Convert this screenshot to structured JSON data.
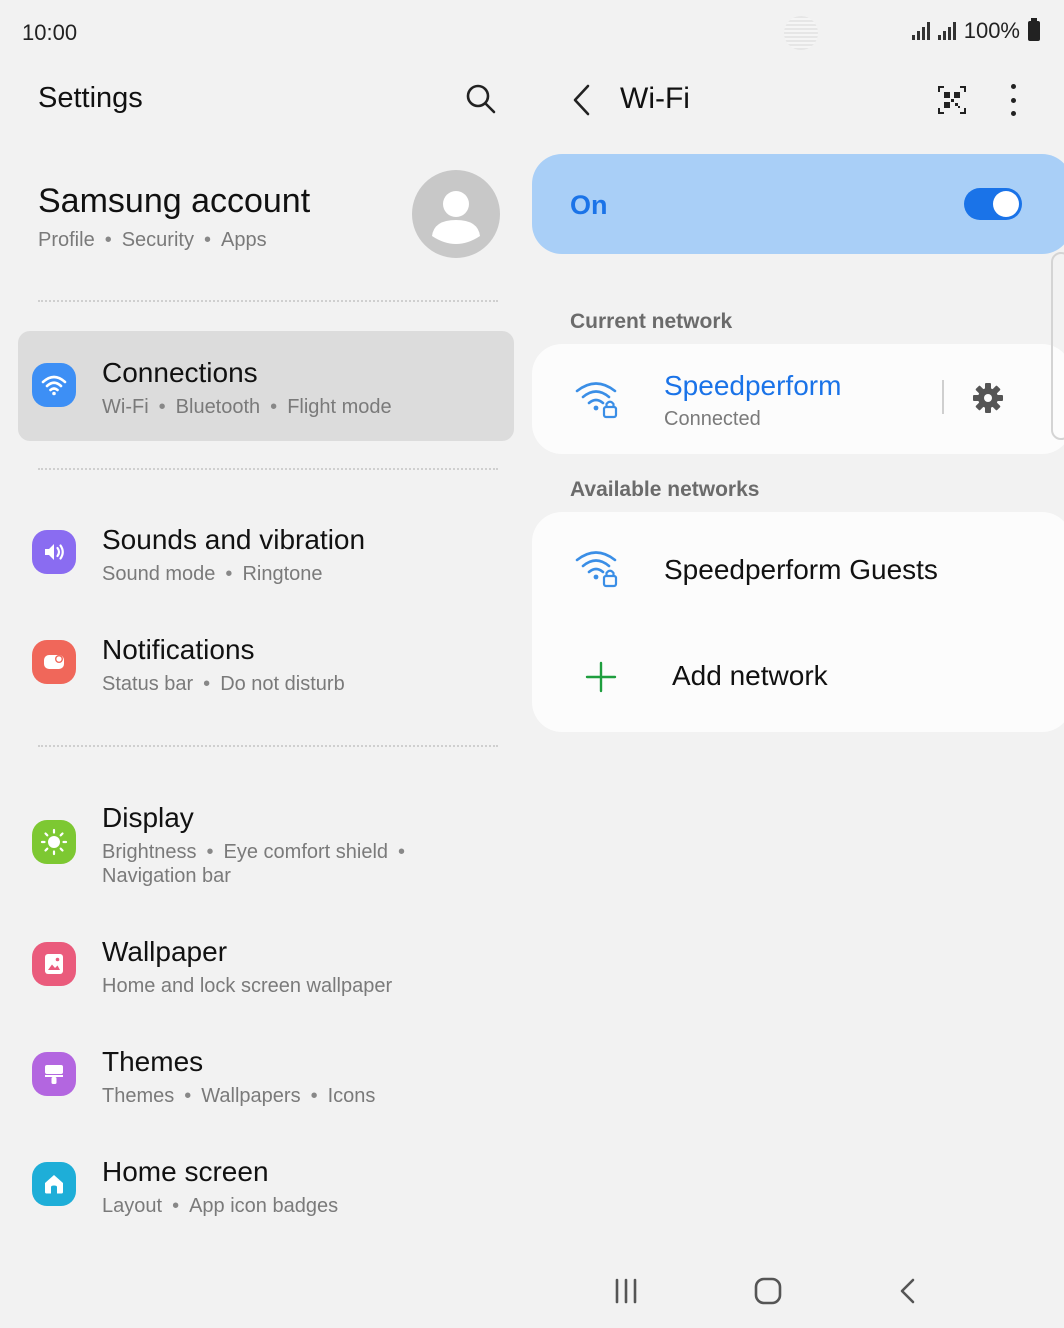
{
  "status_bar": {
    "time": "10:00",
    "battery": "100%"
  },
  "left": {
    "title": "Settings",
    "account": {
      "title": "Samsung account",
      "subs": [
        "Profile",
        "Security",
        "Apps"
      ]
    },
    "items": [
      {
        "title": "Connections",
        "subs": [
          "Wi-Fi",
          "Bluetooth",
          "Flight mode"
        ],
        "icon": "wifi-icon",
        "color": "#3d8ff5",
        "selected": true
      },
      {
        "title": "Sounds and vibration",
        "subs": [
          "Sound mode",
          "Ringtone"
        ],
        "icon": "volume-icon",
        "color": "#8a6cf1"
      },
      {
        "title": "Notifications",
        "subs": [
          "Status bar",
          "Do not disturb"
        ],
        "icon": "notification-icon",
        "color": "#f0675a"
      },
      {
        "title": "Display",
        "sub_line1": "Brightness",
        "sub_line1b": "Eye comfort shield",
        "sub_line2": "Navigation bar",
        "icon": "sun-icon",
        "color": "#7dc832"
      },
      {
        "title": "Wallpaper",
        "sub_text": "Home and lock screen wallpaper",
        "icon": "image-icon",
        "color": "#ea5b7c"
      },
      {
        "title": "Themes",
        "subs": [
          "Themes",
          "Wallpapers",
          "Icons"
        ],
        "icon": "paintbrush-icon",
        "color": "#b366e0"
      },
      {
        "title": "Home screen",
        "subs": [
          "Layout",
          "App icon badges"
        ],
        "icon": "home-icon",
        "color": "#1eaed8"
      }
    ]
  },
  "right": {
    "title": "Wi-Fi",
    "on_label": "On",
    "toggle_state": "on",
    "current_section": "Current network",
    "current_network": {
      "name": "Speedperform",
      "status": "Connected"
    },
    "available_section": "Available networks",
    "available_networks": [
      {
        "name": "Speedperform Guests"
      }
    ],
    "add_network": "Add network"
  },
  "colors": {
    "accent": "#1a73e8",
    "on_card": "#a9cff7",
    "add_green": "#1e9e3e"
  }
}
